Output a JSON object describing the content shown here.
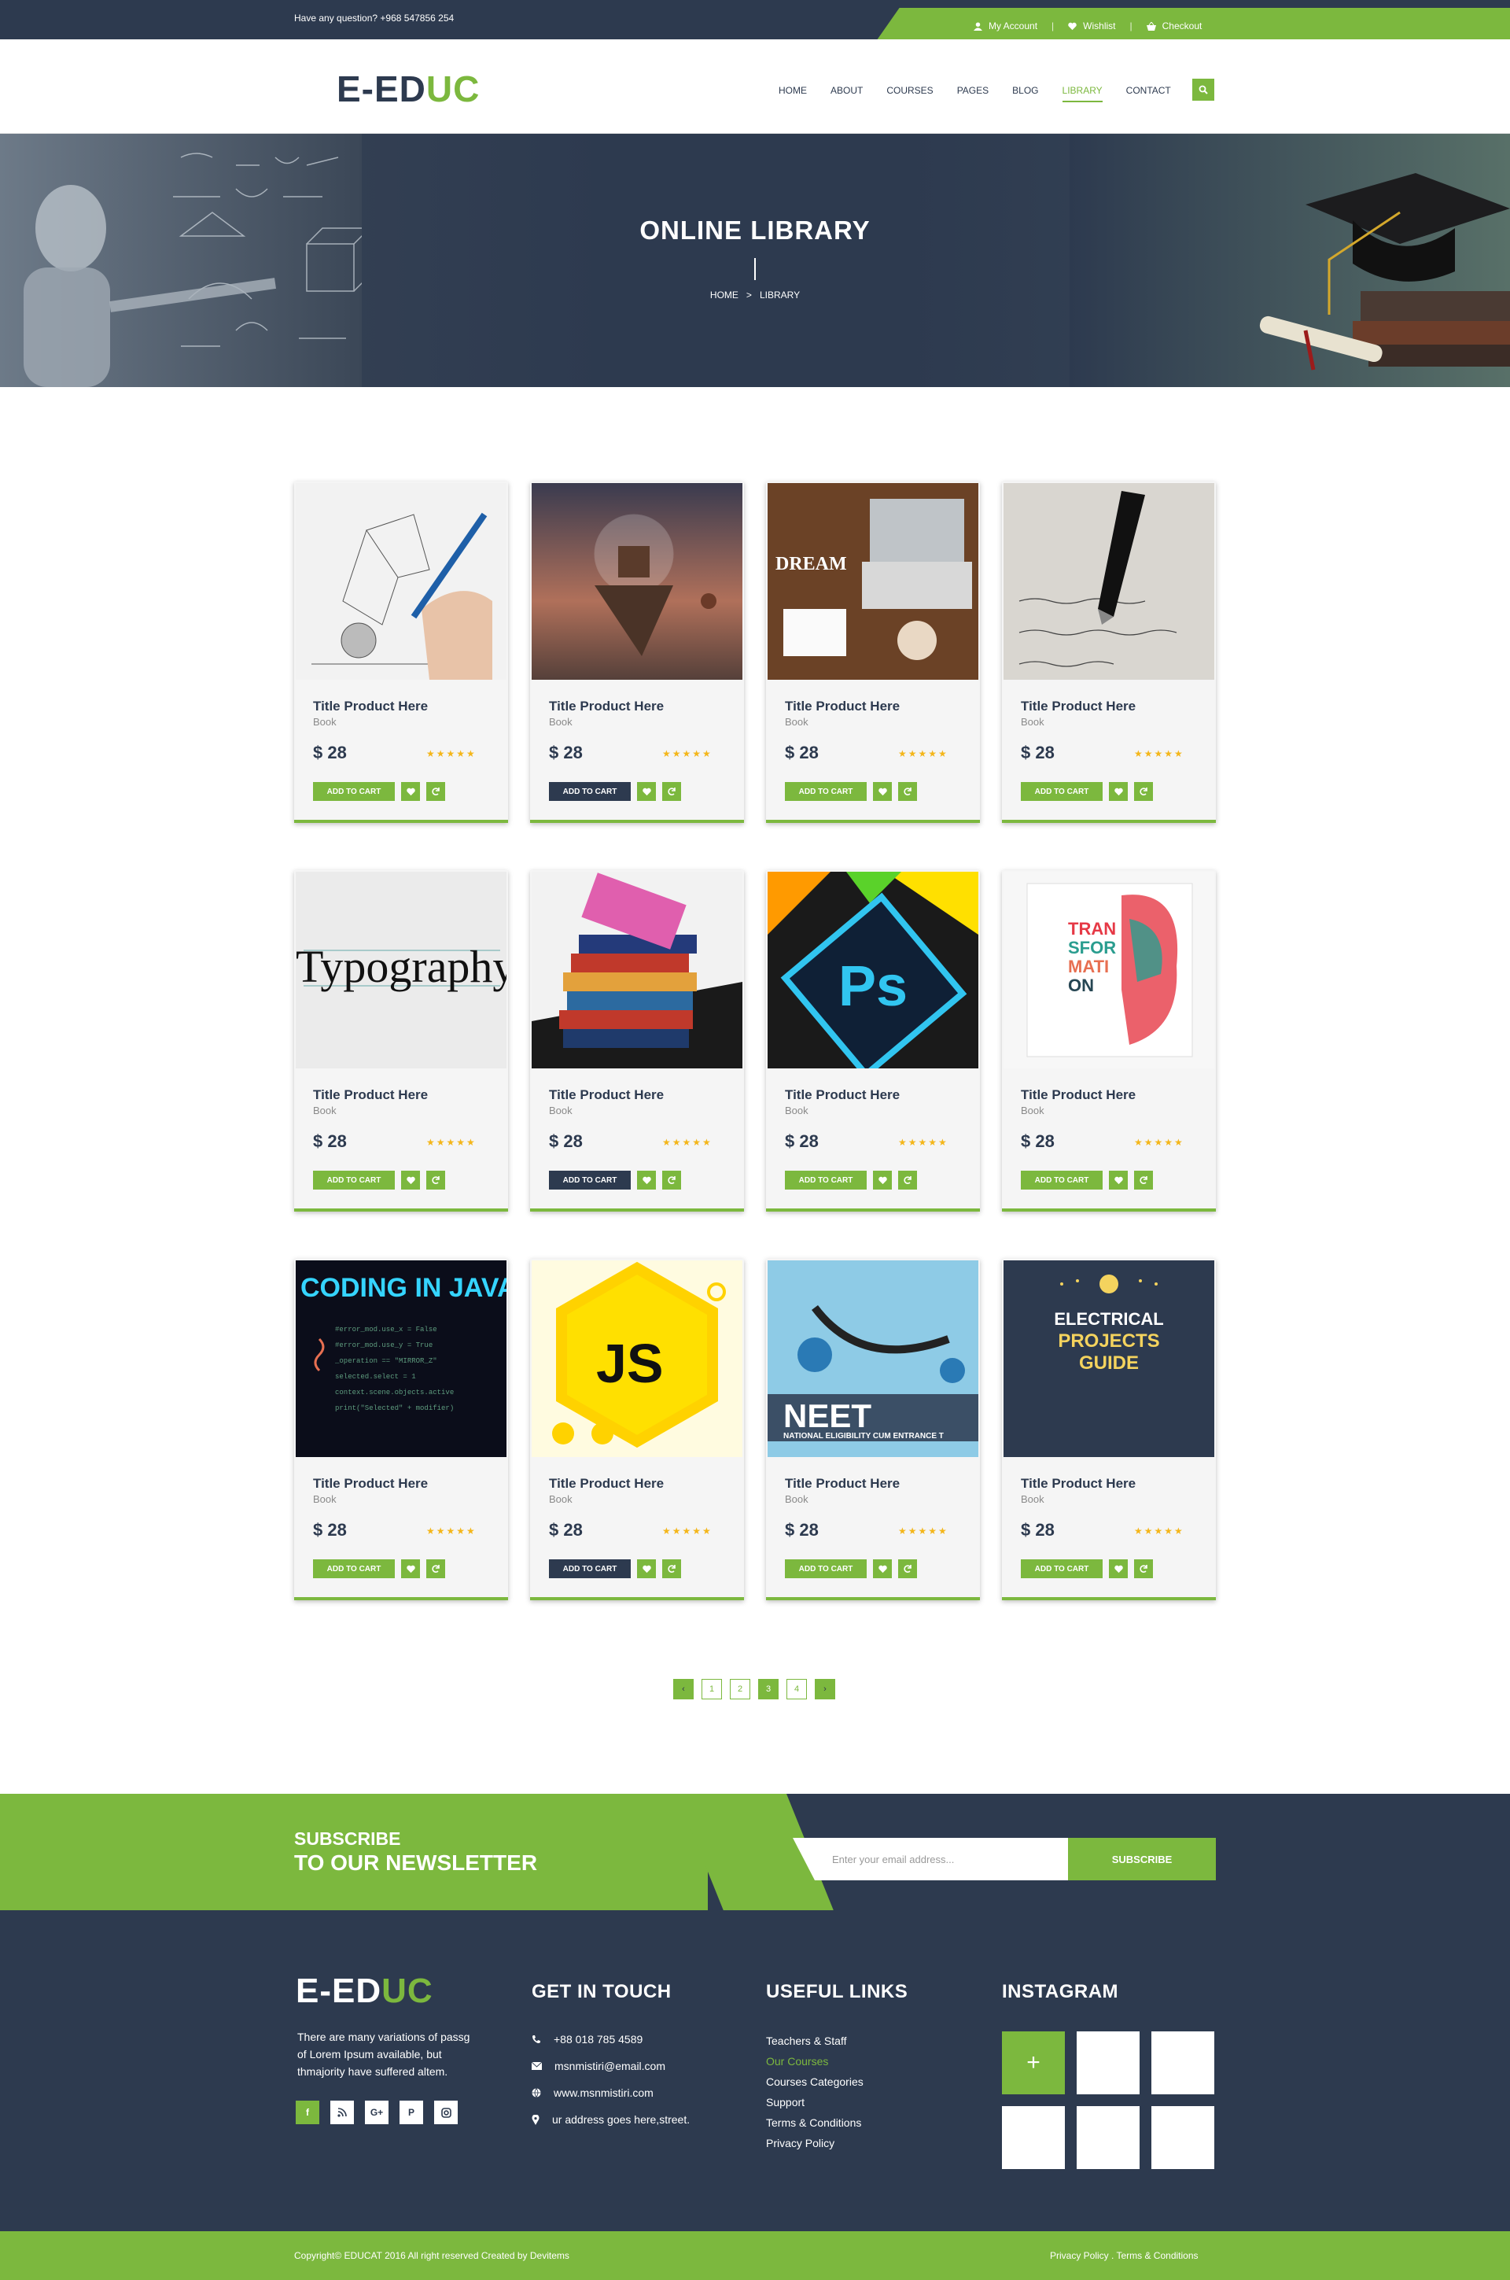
{
  "topbar": {
    "question": "Have any question? +968 547856 254",
    "my_account": "My Account",
    "wishlist": "Wishlist",
    "checkout": "Checkout"
  },
  "logo": {
    "part1": "E-ED",
    "part2": "UC"
  },
  "menu": [
    {
      "label": "HOME"
    },
    {
      "label": "ABOUT"
    },
    {
      "label": "COURSES"
    },
    {
      "label": "PAGES"
    },
    {
      "label": "BLOG"
    },
    {
      "label": "LIBRARY"
    },
    {
      "label": "CONTACT"
    }
  ],
  "hero": {
    "title": "ONLINE LIBRARY",
    "crumb_home": "HOME",
    "crumb_sep": ">",
    "crumb_current": "LIBRARY"
  },
  "products": [
    {
      "title": "Title Product Here",
      "subtitle": "Book",
      "price": "$ 28",
      "cart": "ADD TO CART",
      "image": "pencil-sketch"
    },
    {
      "title": "Title Product Here",
      "subtitle": "Book",
      "price": "$ 28",
      "cart": "ADD TO CART",
      "image": "floating-island"
    },
    {
      "title": "Title Product Here",
      "subtitle": "Book",
      "price": "$ 28",
      "cart": "ADD TO CART",
      "image": "dream-laptop-desk",
      "image_text": "DREAM"
    },
    {
      "title": "Title Product Here",
      "subtitle": "Book",
      "price": "$ 28",
      "cart": "ADD TO CART",
      "image": "fountain-pen"
    },
    {
      "title": "Title Product Here",
      "subtitle": "Book",
      "price": "$ 28",
      "cart": "ADD TO CART",
      "image": "typography",
      "image_text": "Typography"
    },
    {
      "title": "Title Product Here",
      "subtitle": "Book",
      "price": "$ 28",
      "cart": "ADD TO CART",
      "image": "book-stack"
    },
    {
      "title": "Title Product Here",
      "subtitle": "Book",
      "price": "$ 28",
      "cart": "ADD TO CART",
      "image": "adobe-icons",
      "image_text": "Ps"
    },
    {
      "title": "Title Product Here",
      "subtitle": "Book",
      "price": "$ 28",
      "cart": "ADD TO CART",
      "image": "transformation-book",
      "image_text": "TRAN SFOR MATI ON"
    },
    {
      "title": "Title Product Here",
      "subtitle": "Book",
      "price": "$ 28",
      "cart": "ADD TO CART",
      "image": "coding-in-java",
      "image_text": "CODING IN JAVA"
    },
    {
      "title": "Title Product Here",
      "subtitle": "Book",
      "price": "$ 28",
      "cart": "ADD TO CART",
      "image": "js-hexagon",
      "image_text": "JS"
    },
    {
      "title": "Title Product Here",
      "subtitle": "Book",
      "price": "$ 28",
      "cart": "ADD TO CART",
      "image": "neet-stethoscope",
      "image_text": "NEET",
      "image_text2": "NATIONAL ELIGIBILITY CUM ENTRANCE T"
    },
    {
      "title": "Title Product Here",
      "subtitle": "Book",
      "price": "$ 28",
      "cart": "ADD TO CART",
      "image": "electrical-guide",
      "image_text": "ELECTRICAL",
      "image_text2": "PROJECTS",
      "image_text3": "GUIDE"
    }
  ],
  "rating_stars": "★★★★★",
  "pagination": [
    "1",
    "2",
    "3",
    "4"
  ],
  "pagination_prev": "‹",
  "pagination_next": "›",
  "newsletter": {
    "line1": "SUBSCRIBE",
    "line2": "TO OUR NEWSLETTER",
    "placeholder": "Enter your email address...",
    "button": "SUBSCRIBE"
  },
  "footer": {
    "description": "There are many variations of passg of Lorem Ipsum available, but thmajority have suffered altem.",
    "get_in_touch": "GET IN TOUCH",
    "phone": "+88 018 785 4589",
    "email": "msnmistiri@email.com",
    "website": "www.msnmistiri.com",
    "address": "ur address goes here,street.",
    "useful_links": "USEFUL LINKS",
    "links": [
      "Teachers & Staff",
      "Our Courses",
      "Courses Categories",
      "Support",
      "Terms & Conditions",
      "Privacy Policy"
    ],
    "instagram": "INSTAGRAM",
    "instagram_plus": "+",
    "social": [
      "f",
      "rss",
      "G+",
      "P",
      "ig"
    ]
  },
  "bottom": {
    "copyright": "Copyright© EDUCAT 2016 All right reserved Created by Devitems",
    "right": "Privacy Policy . Terms & Conditions"
  },
  "colors": {
    "green": "#7cb83e",
    "navy": "#2d3a4f",
    "star": "#f4b61a"
  }
}
